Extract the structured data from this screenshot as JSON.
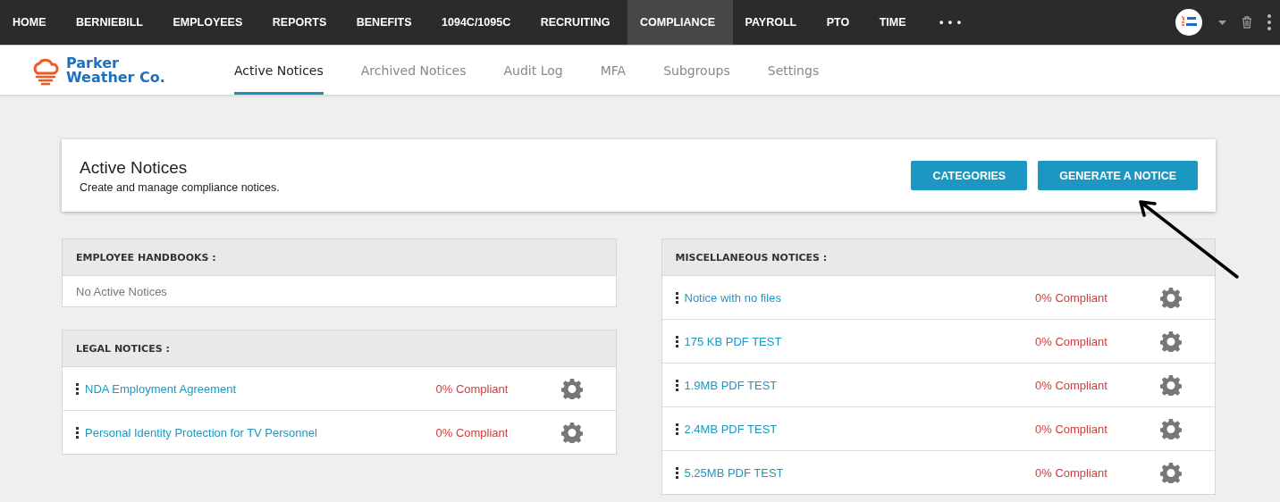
{
  "top_nav": [
    {
      "label": "HOME",
      "selected": false
    },
    {
      "label": "BERNIEBILL",
      "selected": false
    },
    {
      "label": "EMPLOYEES",
      "selected": false
    },
    {
      "label": "REPORTS",
      "selected": false
    },
    {
      "label": "BENEFITS",
      "selected": false
    },
    {
      "label": "1094C/1095C",
      "selected": false
    },
    {
      "label": "RECRUITING",
      "selected": false
    },
    {
      "label": "COMPLIANCE",
      "selected": true
    },
    {
      "label": "PAYROLL",
      "selected": false
    },
    {
      "label": "PTO",
      "selected": false
    },
    {
      "label": "TIME",
      "selected": false
    }
  ],
  "more_label": "• • •",
  "logo": {
    "lines": [
      "Parker",
      "Weather Co."
    ]
  },
  "sub_tabs": [
    {
      "label": "Active Notices",
      "selected": true
    },
    {
      "label": "Archived Notices",
      "selected": false
    },
    {
      "label": "Audit Log",
      "selected": false
    },
    {
      "label": "MFA",
      "selected": false
    },
    {
      "label": "Subgroups",
      "selected": false
    },
    {
      "label": "Settings",
      "selected": false
    }
  ],
  "header": {
    "title": "Active Notices",
    "subtitle": "Create and manage compliance notices.",
    "buttons": [
      "CATEGORIES",
      "GENERATE A NOTICE"
    ]
  },
  "left_sections": [
    {
      "title": "EMPLOYEE HANDBOOKS :",
      "empty_text": "No Active Notices"
    },
    {
      "title": "LEGAL NOTICES :",
      "notices": [
        {
          "name": "NDA Employment Agreement",
          "status": "0% Compliant"
        },
        {
          "name": "Personal Identity Protection for TV Personnel",
          "status": "0% Compliant"
        }
      ]
    }
  ],
  "right_sections": [
    {
      "title": "MISCELLANEOUS NOTICES :",
      "notices": [
        {
          "name": "Notice with no files",
          "status": "0% Compliant"
        },
        {
          "name": "175 KB PDF TEST",
          "status": "0% Compliant"
        },
        {
          "name": "1.9MB PDF TEST",
          "status": "0% Compliant"
        },
        {
          "name": "2.4MB PDF TEST",
          "status": "0% Compliant"
        },
        {
          "name": "5.25MB PDF TEST",
          "status": "0% Compliant"
        }
      ]
    }
  ]
}
